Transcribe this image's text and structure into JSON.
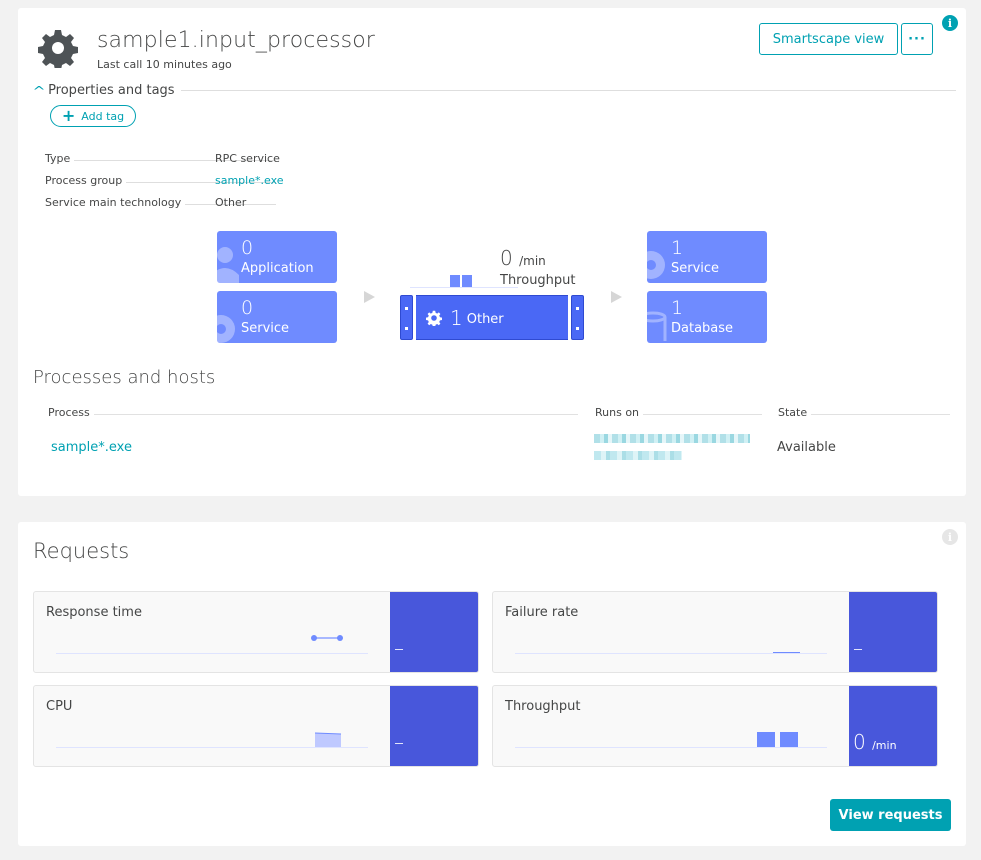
{
  "header": {
    "title": "sample1.input_processor",
    "subtitle": "Last call 10 minutes ago",
    "smartscape_label": "Smartscape view",
    "more_label": "···",
    "info_label": "i",
    "entity_icon": "gear-icon"
  },
  "properties": {
    "section_label": "Properties and tags",
    "add_tag_label": "Add tag",
    "rows": [
      {
        "key": "Type",
        "value": "RPC service"
      },
      {
        "key": "Process group",
        "value": "sample*.exe"
      },
      {
        "key": "Service main technology",
        "value": "Other"
      }
    ]
  },
  "flow": {
    "callers": [
      {
        "count": "0",
        "label": "Application",
        "icon": "user-icon"
      },
      {
        "count": "0",
        "label": "Service",
        "icon": "gear-icon"
      }
    ],
    "center": {
      "count": "1",
      "label": "Other",
      "icon": "gear-icon"
    },
    "throughput": {
      "value": "0",
      "unit": "/min",
      "label": "Throughput"
    },
    "callees": [
      {
        "count": "1",
        "label": "Service",
        "icon": "gear-icon"
      },
      {
        "count": "1",
        "label": "Database",
        "icon": "database-icon"
      }
    ]
  },
  "processes": {
    "heading": "Processes and hosts",
    "columns": [
      "Process",
      "Runs on",
      "State"
    ],
    "rows": [
      {
        "process": "sample*.exe",
        "runs_on": "[redacted host]",
        "state": "Available"
      }
    ]
  },
  "requests": {
    "heading": "Requests",
    "info_label": "i",
    "metrics": [
      {
        "title": "Response time",
        "value": "–",
        "unit": ""
      },
      {
        "title": "Failure rate",
        "value": "–",
        "unit": ""
      },
      {
        "title": "CPU",
        "value": "–",
        "unit": ""
      },
      {
        "title": "Throughput",
        "value": "0",
        "unit": "/min"
      }
    ],
    "view_button_label": "View requests"
  },
  "colors": {
    "accent": "#00a1b2",
    "tile": "#6f8bff",
    "center": "#4a68f5",
    "metric_panel": "#4857db"
  }
}
